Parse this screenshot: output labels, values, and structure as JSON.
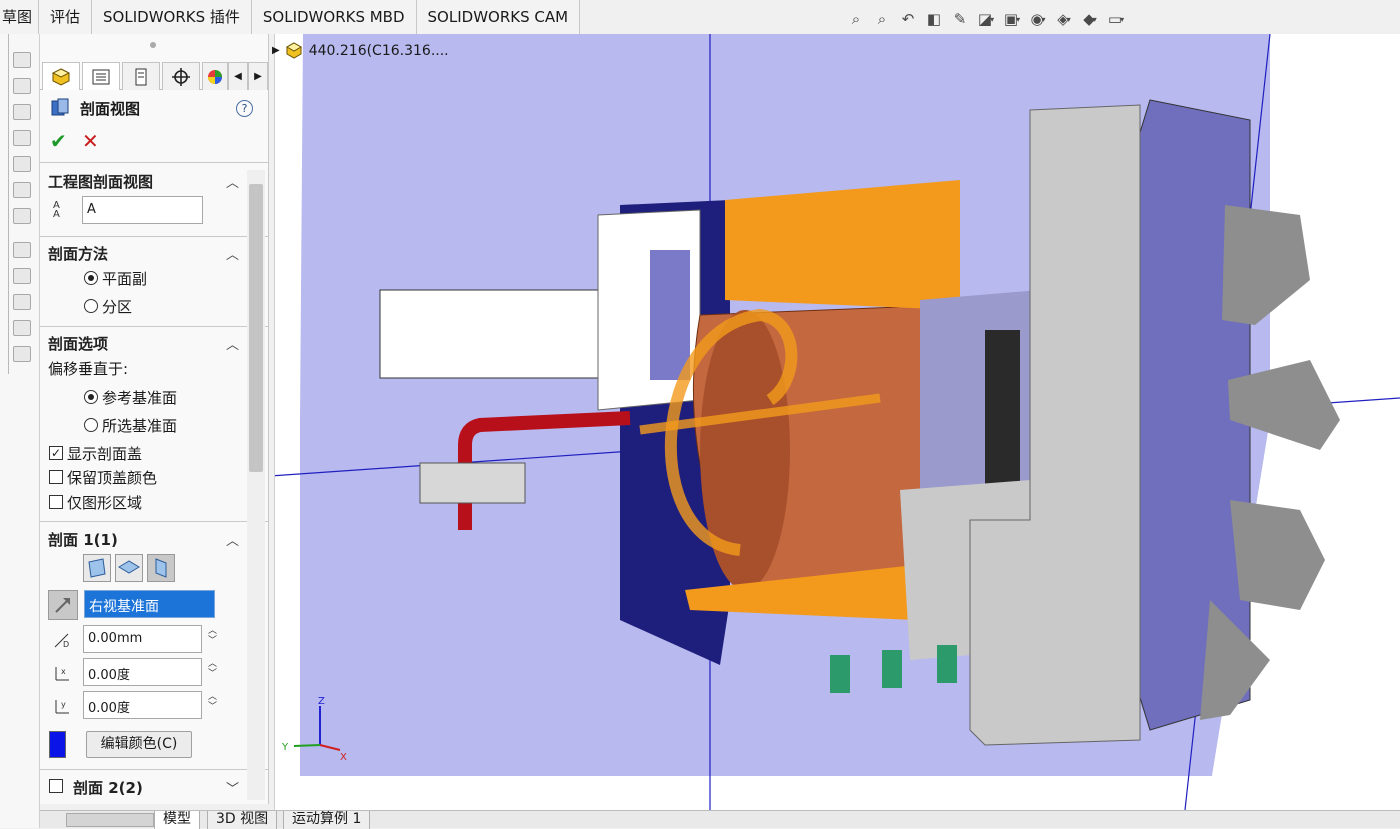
{
  "command_tabs": [
    "草图",
    "评估",
    "SOLIDWORKS 插件",
    "SOLIDWORKS MBD",
    "SOLIDWORKS CAM"
  ],
  "feature_tree": {
    "root_label": "440.216(C16.316...."
  },
  "property_manager": {
    "title": "剖面视图",
    "help": "?",
    "section_drawing": {
      "title": "工程图剖面视图",
      "name_value": "A"
    },
    "section_method": {
      "title": "剖面方法",
      "options": [
        "平面副",
        "分区"
      ],
      "selected": "平面副"
    },
    "section_options": {
      "title": "剖面选项",
      "offset_label": "偏移垂直于:",
      "offset_options": [
        "参考基准面",
        "所选基准面"
      ],
      "offset_selected": "参考基准面",
      "show_cap": "显示剖面盖",
      "show_cap_checked": true,
      "keep_cap_color": "保留顶盖颜色",
      "keep_cap_color_checked": false,
      "graphics_only": "仅图形区域",
      "graphics_only_checked": false
    },
    "section1": {
      "title": "剖面 1(1)",
      "plane_value": "右视基准面",
      "offset_value": "0.00mm",
      "x_rotation_value": "0.00度",
      "y_rotation_value": "0.00度",
      "color_swatch": "#0a14e6",
      "edit_color_label": "编辑颜色(C)"
    },
    "section2": {
      "title": "剖面 2(2)",
      "checked": false
    }
  },
  "bottom_tabs": [
    "模型",
    "3D 视图",
    "运动算例 1"
  ],
  "triad": {
    "x": "X",
    "y": "Y",
    "z": "Z"
  },
  "colors": {
    "section_plane": "#b7b9ef",
    "copper": "#c4693f",
    "orange": "#f39a1c",
    "steel": "#c9c9c9",
    "turret_blue": "#6f6fbd",
    "accent_blue": "#1d74d8"
  }
}
